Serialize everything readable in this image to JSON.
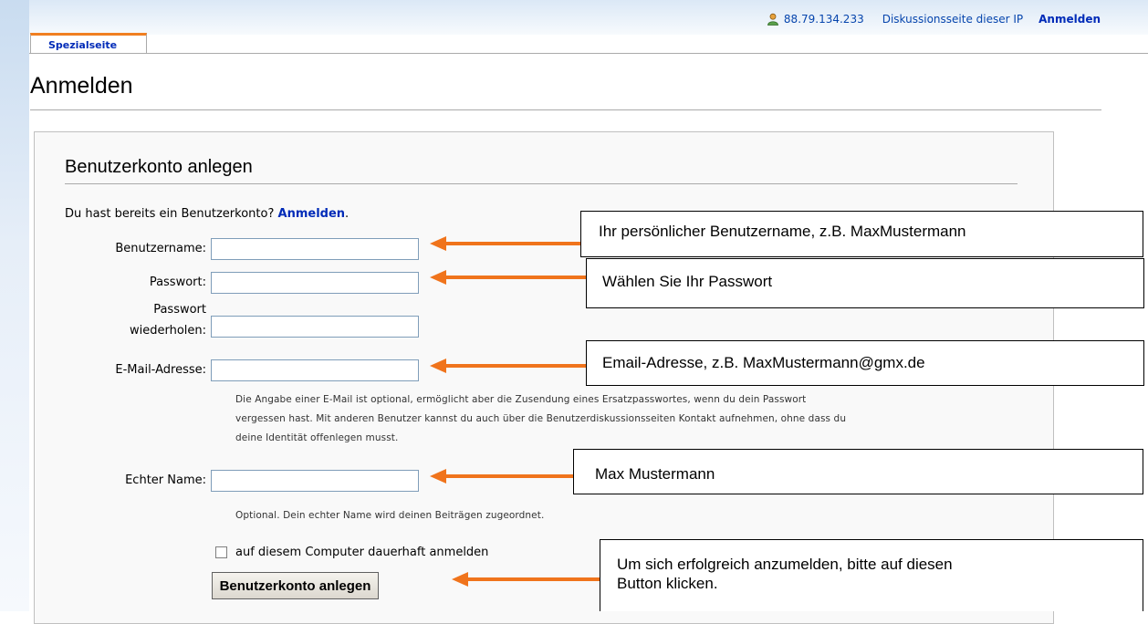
{
  "header": {
    "ip": "88.79.134.233",
    "talk_link": "Diskussionsseite dieser IP",
    "login_link": "Anmelden",
    "tab_label": "Spezialseite"
  },
  "page": {
    "title": "Anmelden"
  },
  "form": {
    "heading": "Benutzerkonto anlegen",
    "already_text": "Du hast bereits ein Benutzerkonto?",
    "already_link": "Anmelden",
    "already_period": ".",
    "username_label": "Benutzername:",
    "password_label": "Passwort:",
    "password_repeat_label_1": "Passwort",
    "password_repeat_label_2": "wiederholen:",
    "email_label": "E-Mail-Adresse:",
    "email_help_1": "Die Angabe einer E-Mail ist optional, ermöglicht aber die Zusendung eines Ersatzpasswortes, wenn du dein Passwort",
    "email_help_2": "vergessen hast. Mit anderen Benutzer kannst du auch über die Benutzerdiskussionsseiten Kontakt aufnehmen, ohne dass du",
    "email_help_3": "deine Identität offenlegen musst.",
    "realname_label": "Echter Name:",
    "realname_help": "Optional. Dein echter Name wird deinen Beiträgen zugeordnet.",
    "remember_label": "auf diesem Computer dauerhaft anmelden",
    "submit_label": "Benutzerkonto anlegen",
    "values": {
      "username": "",
      "password": "",
      "password_repeat": "",
      "email": "",
      "realname": ""
    }
  },
  "callouts": {
    "username": "Ihr persönlicher Benutzername, z.B. MaxMustermann",
    "password": "Wählen Sie Ihr Passwort",
    "email": "Email-Adresse, z.B. MaxMustermann@gmx.de",
    "realname": "Max Mustermann",
    "submit_1": "Um sich erfolgreich anzumelden, bitte auf diesen",
    "submit_2": "Button klicken."
  },
  "colors": {
    "arrow": "#f0741c",
    "link": "#002bb8",
    "tab_accent": "#f07f21"
  },
  "icons": {
    "user": "user-icon",
    "checkbox": "checkbox-unchecked-icon"
  }
}
